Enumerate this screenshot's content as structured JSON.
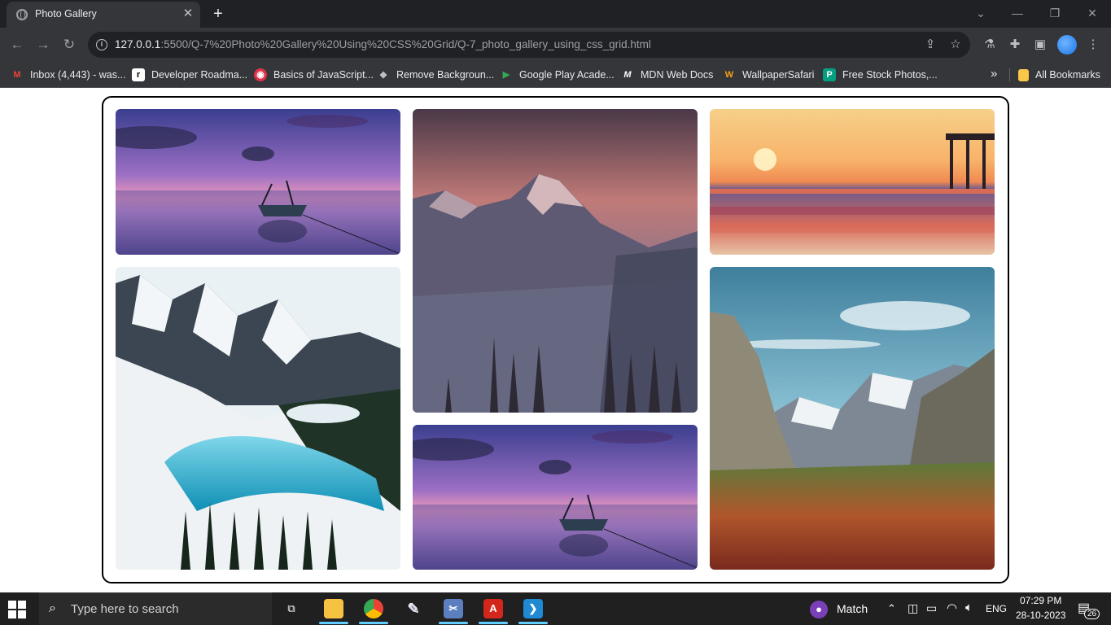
{
  "browser": {
    "tab_title": "Photo Gallery",
    "url_host": "127.0.0.1",
    "url_rest": ":5500/Q-7%20Photo%20Gallery%20Using%20CSS%20Grid/Q-7_photo_gallery_using_css_grid.html"
  },
  "bookmarks": [
    {
      "label": "Inbox (4,443) - was...",
      "icon": "gmail-icon"
    },
    {
      "label": "Developer Roadma...",
      "icon": "roadmap-icon"
    },
    {
      "label": "Basics of JavaScript...",
      "icon": "js-icon"
    },
    {
      "label": "Remove Backgroun...",
      "icon": "removebg-icon"
    },
    {
      "label": "Google Play Acade...",
      "icon": "google-play-icon"
    },
    {
      "label": "MDN Web Docs",
      "icon": "mdn-icon"
    },
    {
      "label": "WallpaperSafari",
      "icon": "wallpapersafari-icon"
    },
    {
      "label": "Free Stock Photos,...",
      "icon": "stock-photos-icon"
    }
  ],
  "bookmarks_folder": "All Bookmarks",
  "gallery": {
    "photos": [
      {
        "name": "lake-boat-sunset-photo",
        "scene": "boat on calm lake at purple sunset"
      },
      {
        "name": "mountain-peak-dusk-photo",
        "scene": "snowy mountain peak at dusk with pine trees"
      },
      {
        "name": "ocean-pier-sunset-photo",
        "scene": "ocean sunset with pier"
      },
      {
        "name": "glacier-lake-photo",
        "scene": "turquoise glacier lake among snowy mountains"
      },
      {
        "name": "lake-boat-sunset-photo-2",
        "scene": "boat on calm lake at purple sunset"
      },
      {
        "name": "yosemite-valley-photo",
        "scene": "valley with cliffs and autumn forest"
      }
    ]
  },
  "taskbar": {
    "search_placeholder": "Type here to search",
    "weather_label": "Match",
    "language": "ENG",
    "time": "07:29 PM",
    "date": "28-10-2023",
    "notification_count": "26"
  }
}
